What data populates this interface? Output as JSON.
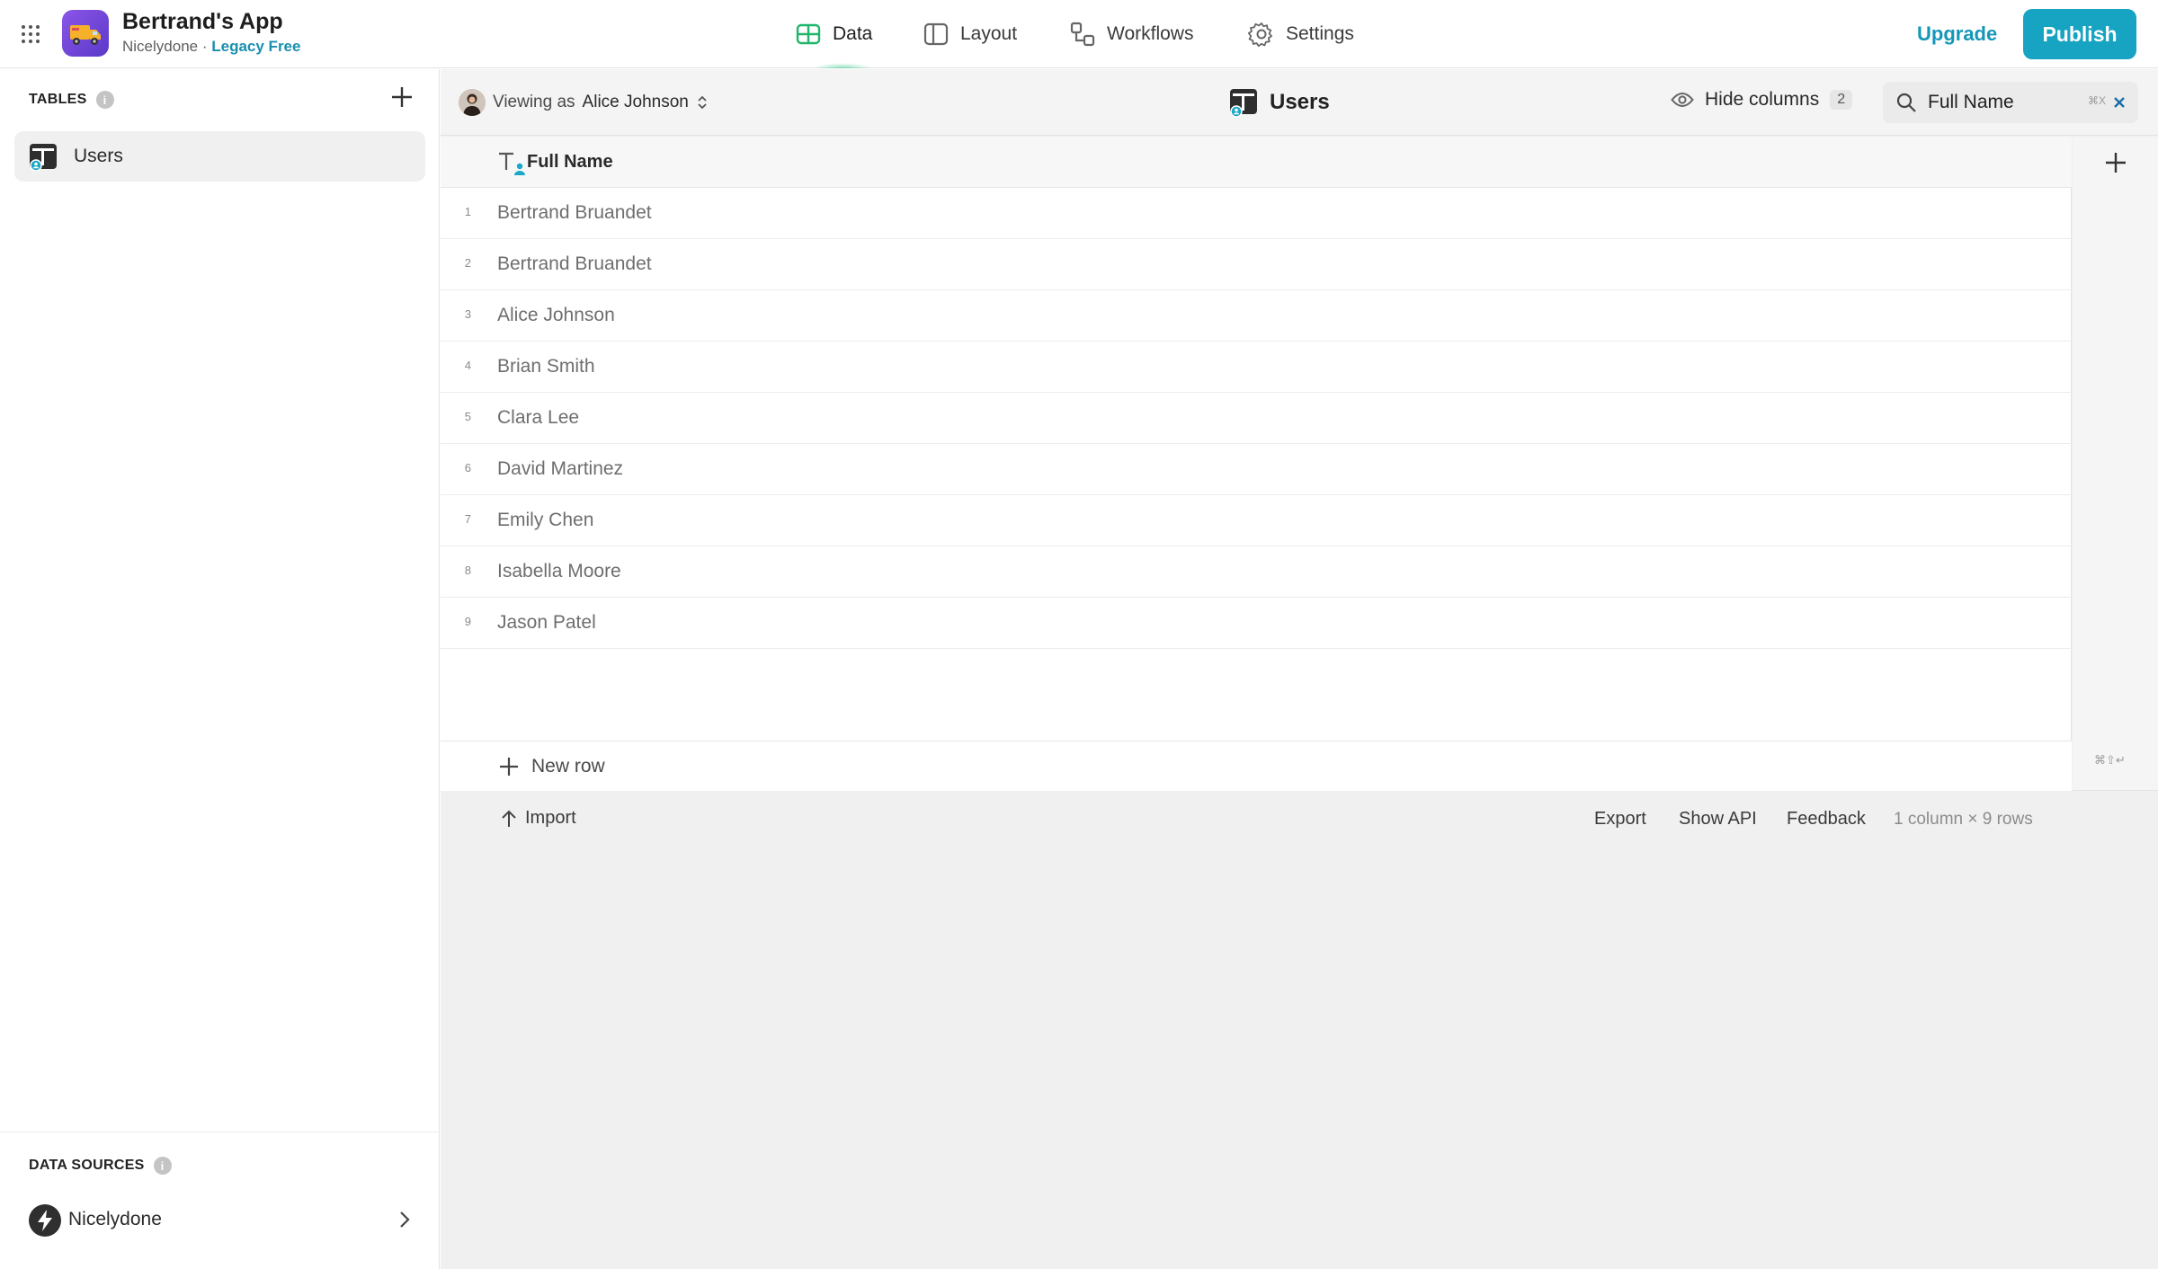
{
  "app": {
    "name": "Bertrand's App",
    "org": "Nicelydone",
    "separator": "·",
    "plan": "Legacy Free"
  },
  "nav": {
    "data": "Data",
    "layout": "Layout",
    "workflows": "Workflows",
    "settings": "Settings"
  },
  "header": {
    "upgrade": "Upgrade",
    "publish": "Publish"
  },
  "sidebar": {
    "tables_title": "TABLES",
    "info": "i",
    "tables": [
      {
        "label": "Users"
      }
    ],
    "data_sources_title": "DATA SOURCES",
    "data_sources": [
      {
        "label": "Nicelydone"
      }
    ]
  },
  "toolbar": {
    "viewing_prefix": "Viewing as",
    "viewing_user": "Alice Johnson",
    "table_title": "Users",
    "hide_columns": "Hide columns",
    "hidden_count": "2",
    "search_value": "Full Name",
    "search_shortcut": "⌘X"
  },
  "table": {
    "column_header": "Full Name",
    "rows": [
      {
        "num": "1",
        "value": "Bertrand Bruandet"
      },
      {
        "num": "2",
        "value": "Bertrand Bruandet"
      },
      {
        "num": "3",
        "value": "Alice Johnson"
      },
      {
        "num": "4",
        "value": "Brian Smith"
      },
      {
        "num": "5",
        "value": "Clara Lee"
      },
      {
        "num": "6",
        "value": "David Martinez"
      },
      {
        "num": "7",
        "value": "Emily Chen"
      },
      {
        "num": "8",
        "value": "Isabella Moore"
      },
      {
        "num": "9",
        "value": "Jason Patel"
      }
    ],
    "new_row": "New row",
    "new_row_shortcut": "⌘⇧↵"
  },
  "footer": {
    "import": "Import",
    "export": "Export",
    "show_api": "Show API",
    "feedback": "Feedback",
    "meta": "1 column × 9 rows"
  },
  "colors": {
    "accent": "#17a3c2",
    "data_tab": "#1fb56a",
    "logo": "#6a45d8"
  },
  "icons": {
    "menu": "grid-dots-icon",
    "data": "table-icon",
    "layout": "layout-icon",
    "workflows": "workflow-icon",
    "settings": "gear-icon",
    "search": "search-icon",
    "hide": "eye-icon"
  }
}
